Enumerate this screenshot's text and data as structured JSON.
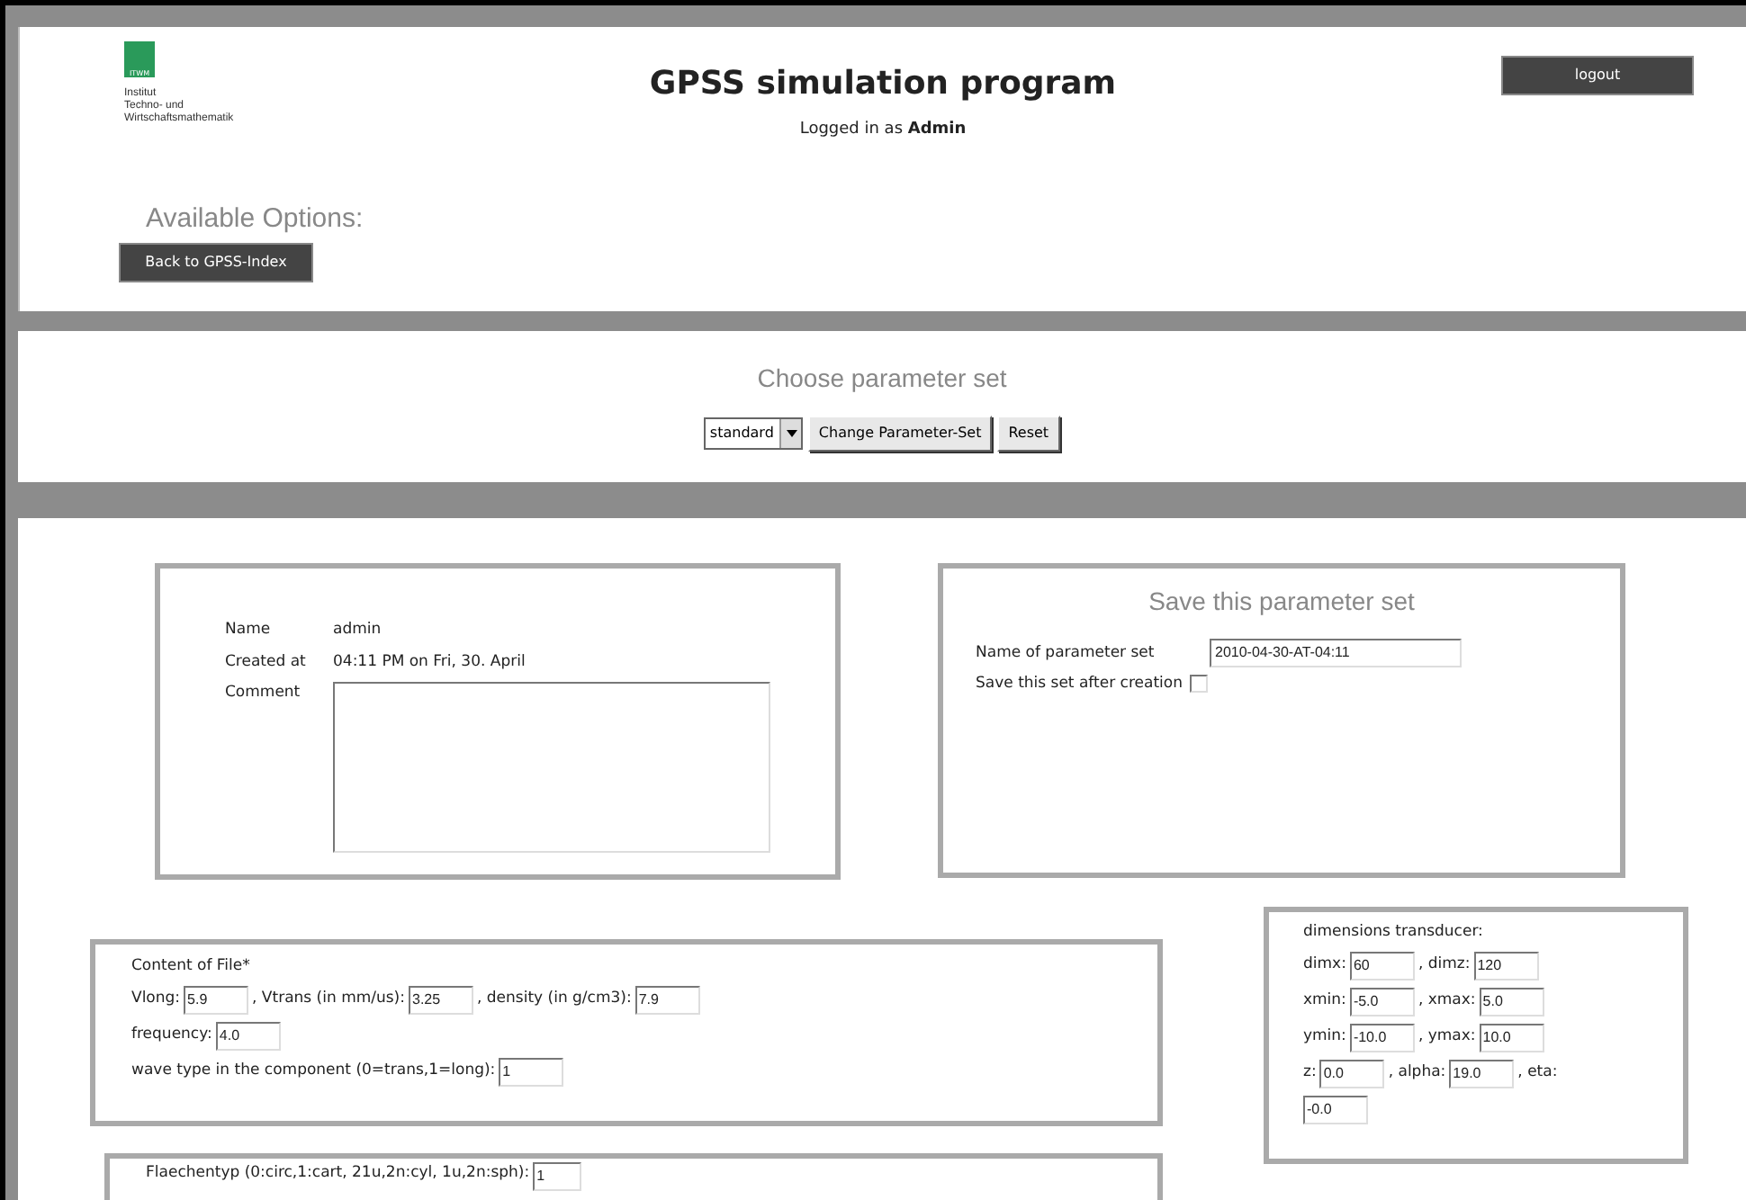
{
  "header": {
    "logo_text": "ITWM",
    "institute": [
      "Institut",
      "Techno- und",
      "Wirtschaftsmathematik"
    ],
    "title": "GPSS simulation program",
    "logged_in": "Logged in as **Admin**",
    "logout": "logout",
    "options_heading": "Available Options:",
    "back_button": "Back to GPSS-Index"
  },
  "choose": {
    "heading": "Choose parameter set",
    "select_value": "standard",
    "buttons": [
      "Change Parameter-Set",
      "Reset"
    ]
  },
  "info": {
    "rows": [
      {
        "label": "Name",
        "value": "admin"
      },
      {
        "label": "Created at",
        "value": "04:11 PM on Fri, 30. April"
      }
    ],
    "comment_label": "Comment"
  },
  "save": {
    "heading": "Save this parameter set",
    "name_label": "Name of parameter set",
    "name_value": "2010-04-30-AT-04:11",
    "save_label": "Save this set after creation",
    "save_checked": false
  },
  "content_file": {
    "heading": "Content of File*",
    "rows": [
      [
        {
          "label": "Vlong:",
          "value": "5.9"
        },
        {
          "label": ", Vtrans (in mm/us):",
          "value": "3.25"
        },
        {
          "label": ", density (in g/cm3):",
          "value": "7.9"
        }
      ],
      [
        {
          "label": "frequency:",
          "value": "4.0"
        }
      ],
      [
        {
          "label": "wave type in the component (0=trans,1=long):",
          "value": "1"
        }
      ]
    ]
  },
  "dimensions": {
    "heading": "dimensions transducer:",
    "rows": [
      [
        {
          "label": "dimx:",
          "value": "60"
        },
        {
          "label": ", dimz:",
          "value": "120"
        }
      ],
      [
        {
          "label": "xmin:",
          "value": "-5.0"
        },
        {
          "label": ", xmax:",
          "value": "5.0"
        }
      ],
      [
        {
          "label": "ymin:",
          "value": "-10.0"
        },
        {
          "label": ", ymax:",
          "value": "10.0"
        }
      ],
      [
        {
          "label": "z:",
          "value": "0.0"
        },
        {
          "label": ", alpha:",
          "value": "19.0"
        },
        {
          "label": ", eta:"
        }
      ],
      [
        {
          "value": "-0.0"
        }
      ]
    ]
  },
  "surface": {
    "label": "Flaechentyp (0:circ,1:cart, 21u,2n:cyl, 1u,2n:sph):",
    "value": "1"
  }
}
